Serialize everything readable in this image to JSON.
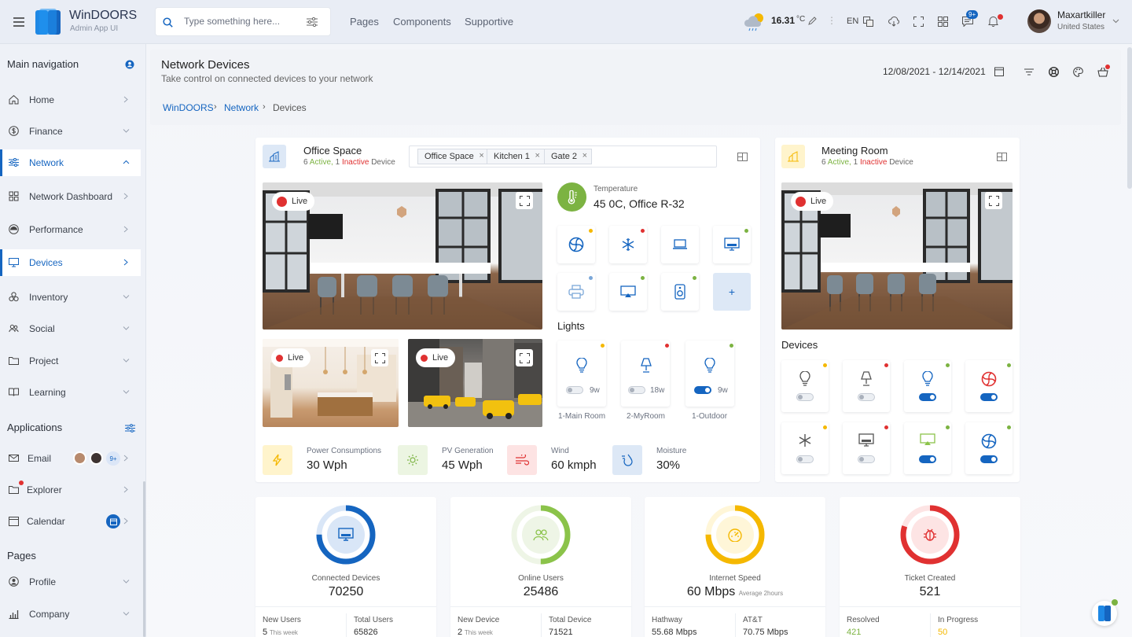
{
  "app": {
    "title": "WinDOORS",
    "subtitle": "Admin App UI"
  },
  "search": {
    "placeholder": "Type something here..."
  },
  "topnav": [
    "Pages",
    "Components",
    "Supportive"
  ],
  "weather": {
    "temp": "16.31",
    "unit": "°C"
  },
  "lang": "EN",
  "notifications_badge": "9+",
  "user": {
    "name": "Maxartkiller",
    "location": "United States"
  },
  "sidebar": {
    "main_heading": "Main navigation",
    "items": [
      {
        "label": "Home",
        "icon": "home-icon"
      },
      {
        "label": "Finance",
        "icon": "dollar-icon"
      },
      {
        "label": "Network",
        "icon": "sliders-icon"
      },
      {
        "label": "Network Dashboard",
        "icon": "grid-icon"
      },
      {
        "label": "Performance",
        "icon": "gauge-icon"
      },
      {
        "label": "Devices",
        "icon": "monitor-icon"
      },
      {
        "label": "Inventory",
        "icon": "boxes-icon"
      },
      {
        "label": "Social",
        "icon": "people-icon"
      },
      {
        "label": "Project",
        "icon": "folder-icon"
      },
      {
        "label": "Learning",
        "icon": "book-icon"
      }
    ],
    "apps_heading": "Applications",
    "apps": [
      {
        "label": "Email",
        "badge": "9+"
      },
      {
        "label": "Explorer"
      },
      {
        "label": "Calendar"
      }
    ],
    "pages_heading": "Pages",
    "pages": [
      {
        "label": "Profile"
      },
      {
        "label": "Company"
      }
    ]
  },
  "page": {
    "title": "Network Devices",
    "subtitle": "Take control on connected devices to your network",
    "date_range": "12/08/2021 - 12/14/2021",
    "breadcrumb": [
      "WinDOORS",
      "Network",
      "Devices"
    ]
  },
  "office": {
    "title": "Office Space",
    "active_count": "6",
    "active_label": "Active,",
    "inactive_count": "1",
    "inactive_label": "Inactive",
    "device_label": "Device",
    "chips": [
      "Office Space",
      "Kitchen 1",
      "Gate 2"
    ],
    "live": "Live",
    "temperature_label": "Temperature",
    "temperature_value": "45",
    "temperature_unit": "0C, Office R-32",
    "lights_heading": "Lights",
    "lights": [
      {
        "watt": "9w",
        "name": "1-Main Room",
        "on": false
      },
      {
        "watt": "18w",
        "name": "2-MyRoom",
        "on": false
      },
      {
        "watt": "9w",
        "name": "1-Outdoor",
        "on": true
      }
    ],
    "stats": [
      {
        "label": "Power Consumptions",
        "value": "30 Wph"
      },
      {
        "label": "PV Generation",
        "value": "45 Wph"
      },
      {
        "label": "Wind",
        "value": "60 kmph"
      },
      {
        "label": "Moisture",
        "value": "30%"
      }
    ],
    "add_label": "+"
  },
  "meeting": {
    "title": "Meeting Room",
    "active_count": "6",
    "active_label": "Active,",
    "inactive_count": "1",
    "inactive_label": "Inactive",
    "device_label": "Device",
    "live": "Live",
    "devices_heading": "Devices"
  },
  "kpis": [
    {
      "title": "Connected Devices",
      "value": "70250",
      "percent": 75,
      "color": "#1565c0",
      "foot": [
        {
          "label": "New Users",
          "value": "5",
          "note": "This week"
        },
        {
          "label": "Total Users",
          "value": "65826"
        }
      ]
    },
    {
      "title": "Online Users",
      "value": "25486",
      "percent": 50,
      "color": "#8bc34a",
      "foot": [
        {
          "label": "New Device",
          "value": "2",
          "note": "This week"
        },
        {
          "label": "Total Device",
          "value": "71521"
        }
      ]
    },
    {
      "title": "Internet Speed",
      "value": "60 Mbps",
      "note": "Average 2hours",
      "percent": 75,
      "color": "#f5b800",
      "foot": [
        {
          "label": "Hathway",
          "value": "55.68 Mbps"
        },
        {
          "label": "AT&T",
          "value": "70.75 Mbps"
        }
      ]
    },
    {
      "title": "Ticket Created",
      "value": "521",
      "percent": 80,
      "color": "#e03131",
      "foot": [
        {
          "label": "Resolved",
          "value": "421"
        },
        {
          "label": "In Progress",
          "value": "50"
        }
      ]
    }
  ],
  "colors": {
    "primary": "#1565c0",
    "green": "#8bc34a",
    "yellow": "#f5b800",
    "red": "#e03131"
  }
}
